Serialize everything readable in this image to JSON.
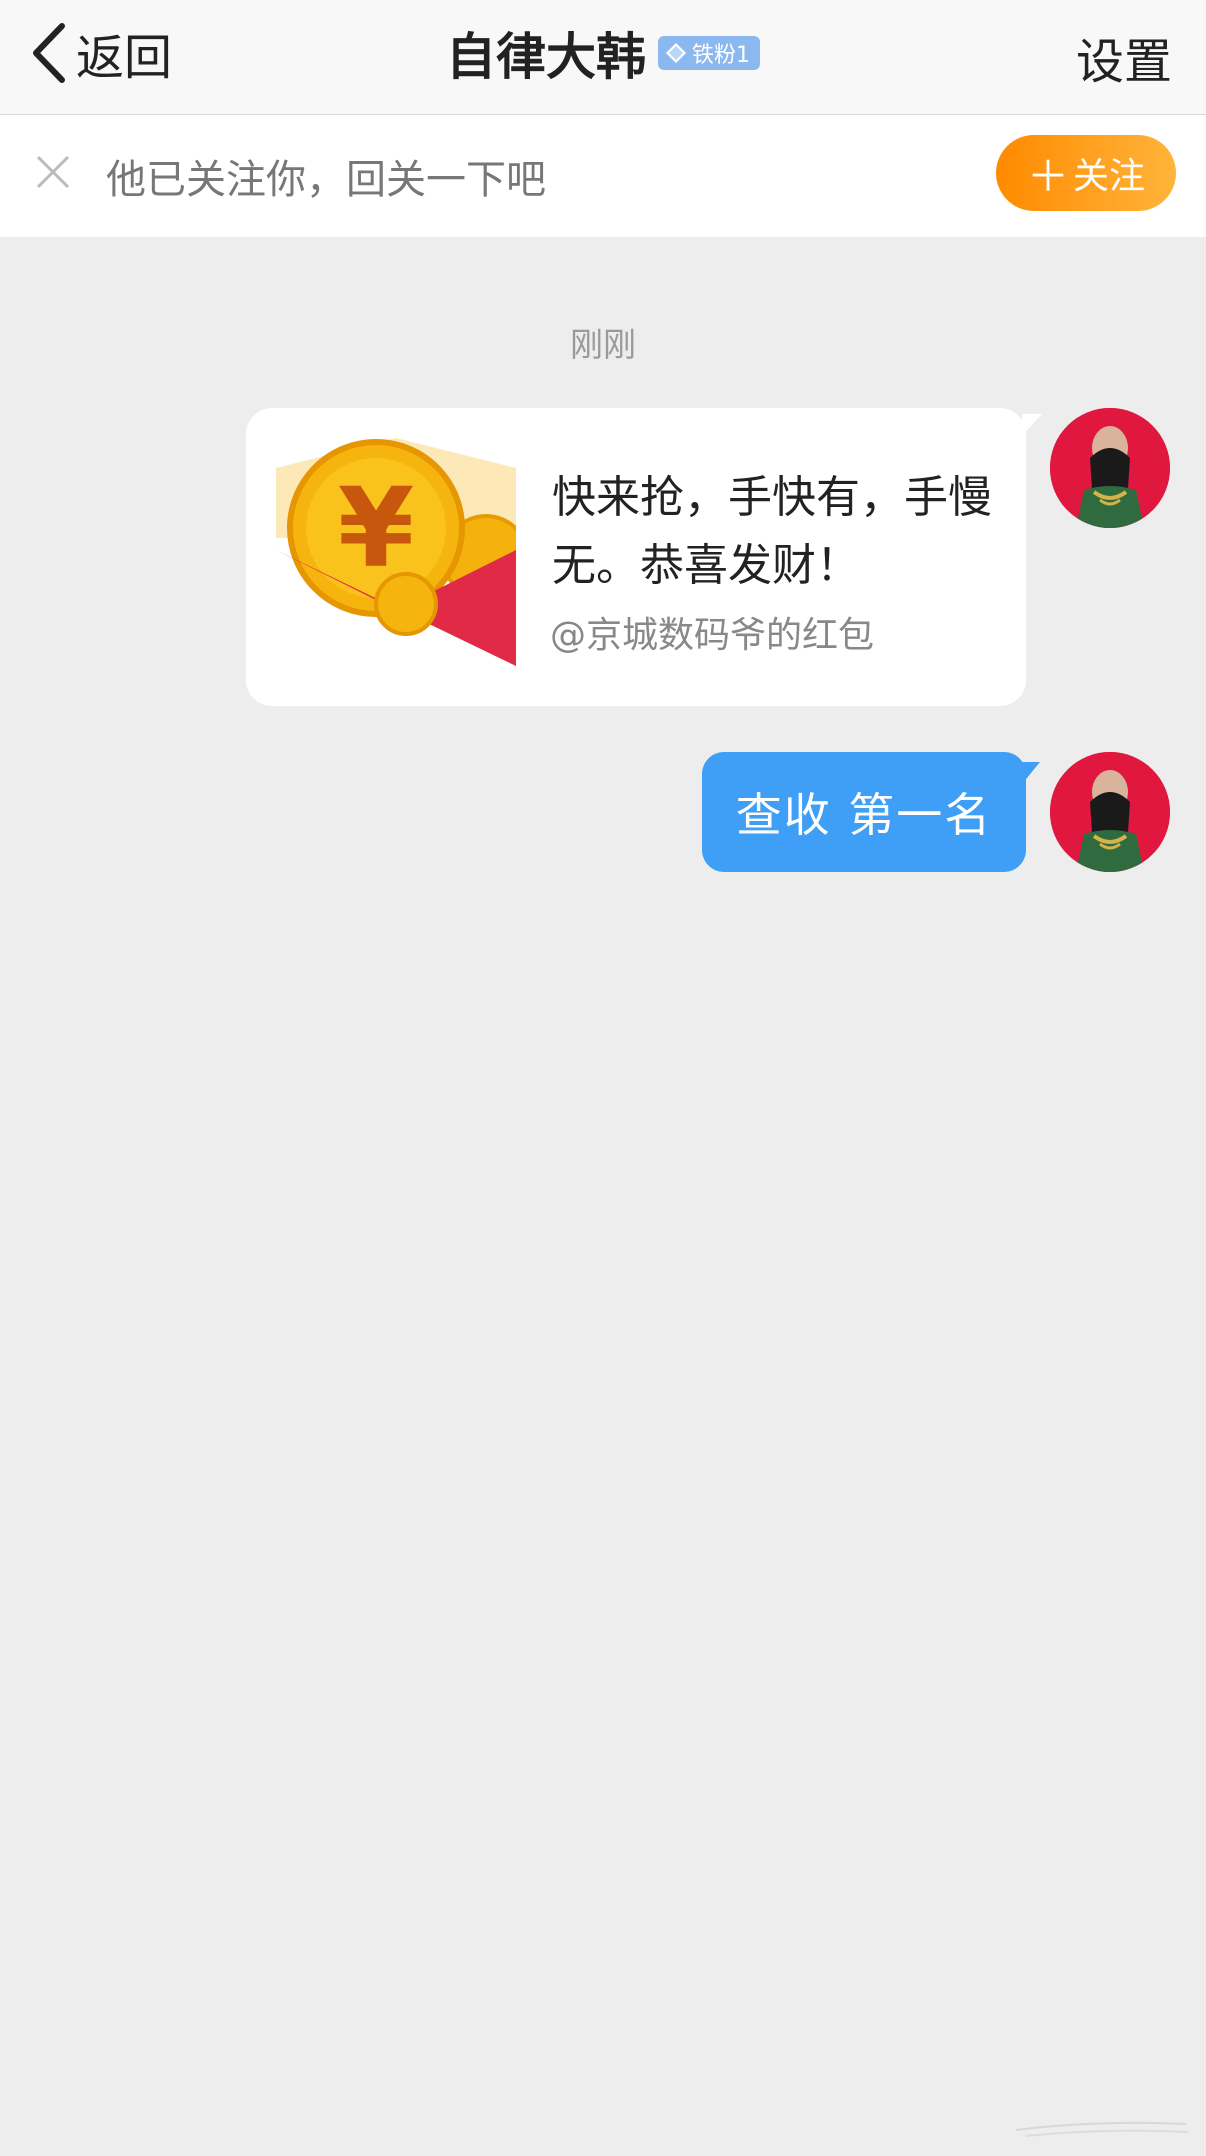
{
  "nav": {
    "back_label": "返回",
    "title": "自律大韩",
    "badge_label": "铁粉1",
    "settings_label": "设置"
  },
  "follow_banner": {
    "text": "他已关注你，回关一下吧",
    "button_label": "关注",
    "button_icon": "plus-icon"
  },
  "chat": {
    "timestamp": "刚刚",
    "messages": [
      {
        "type": "red-packet",
        "text": "快来抢，手快有，手慢无。恭喜发财！",
        "sub": "@京城数码爷的红包"
      },
      {
        "type": "text",
        "text": "查收  第一名"
      }
    ]
  },
  "colors": {
    "follow_button": "#ff8a00",
    "sent_bubble": "#3f9ef5",
    "avatar_bg": "#e0173e",
    "badge": "#8cb8f0"
  }
}
